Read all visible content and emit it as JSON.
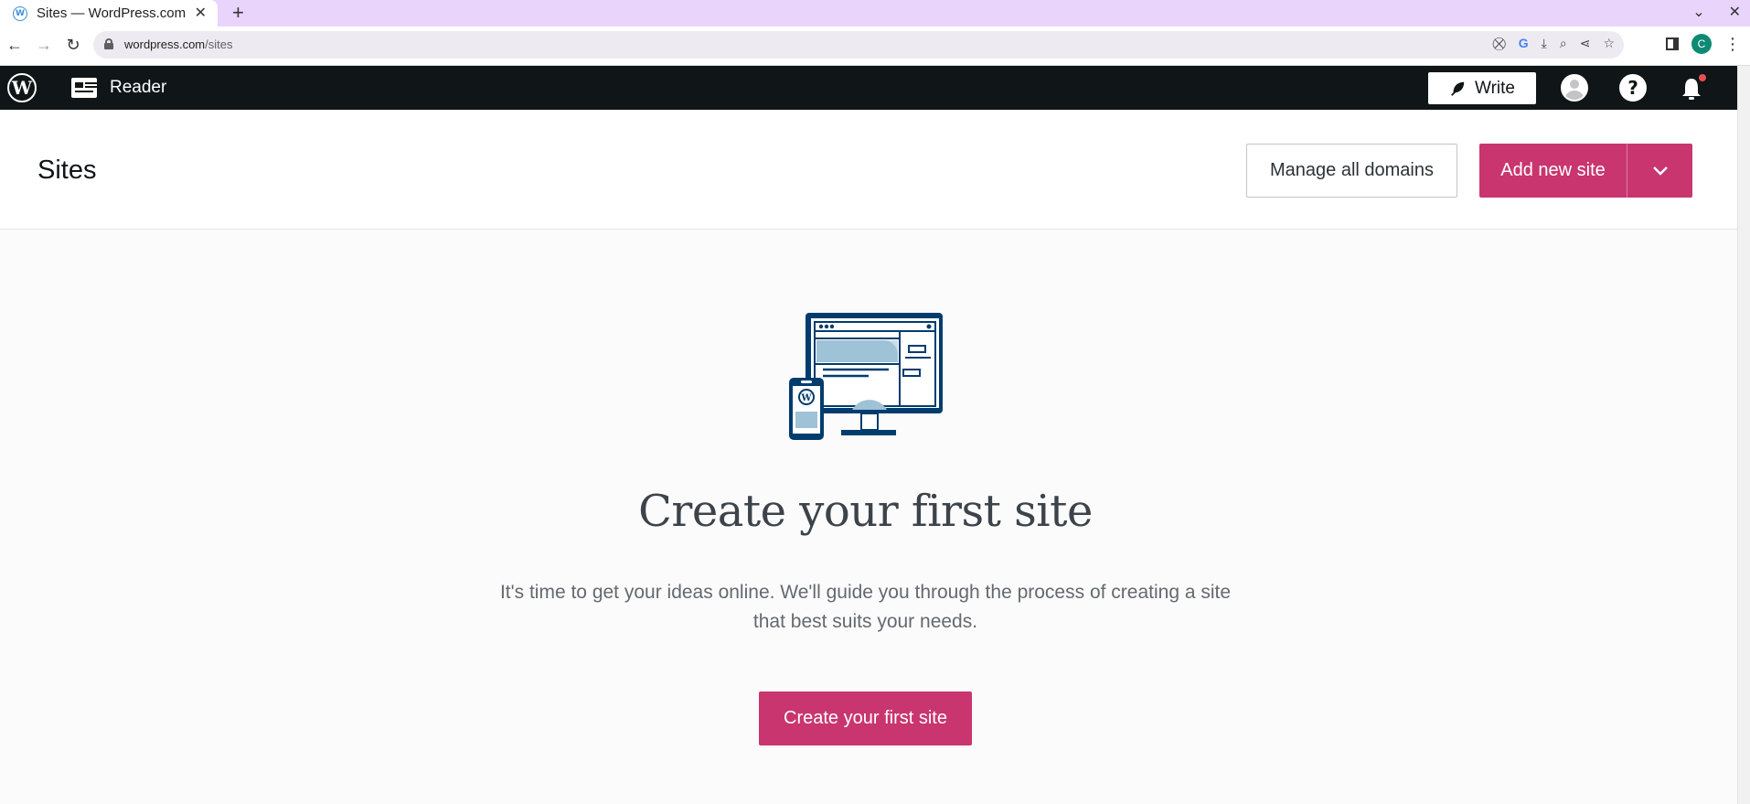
{
  "browser": {
    "tab_title": "Sites — WordPress.com",
    "favicon_letter": "W",
    "close_glyph": "✕",
    "new_tab_glyph": "+",
    "tabstrip_chevron": "⌄",
    "window_close": "✕",
    "url_host": "wordpress.com",
    "url_path": "/sites",
    "profile_initial": "C"
  },
  "masterbar": {
    "logo_letter": "W",
    "reader_label": "Reader",
    "write_label": "Write",
    "help_glyph": "?"
  },
  "header": {
    "title": "Sites",
    "manage_domains_label": "Manage all domains",
    "add_site_label": "Add new site"
  },
  "empty_state": {
    "title": "Create your first site",
    "description": "It's time to get your ideas online. We'll guide you through the process of creating a site that best suits your needs.",
    "cta_label": "Create your first site"
  },
  "colors": {
    "accent": "#c9356e",
    "masterbar_bg": "#101517",
    "tabbar_bg": "#e9d5fb",
    "illustration_navy": "#003c6e",
    "illustration_blue": "#9ec2d6"
  }
}
